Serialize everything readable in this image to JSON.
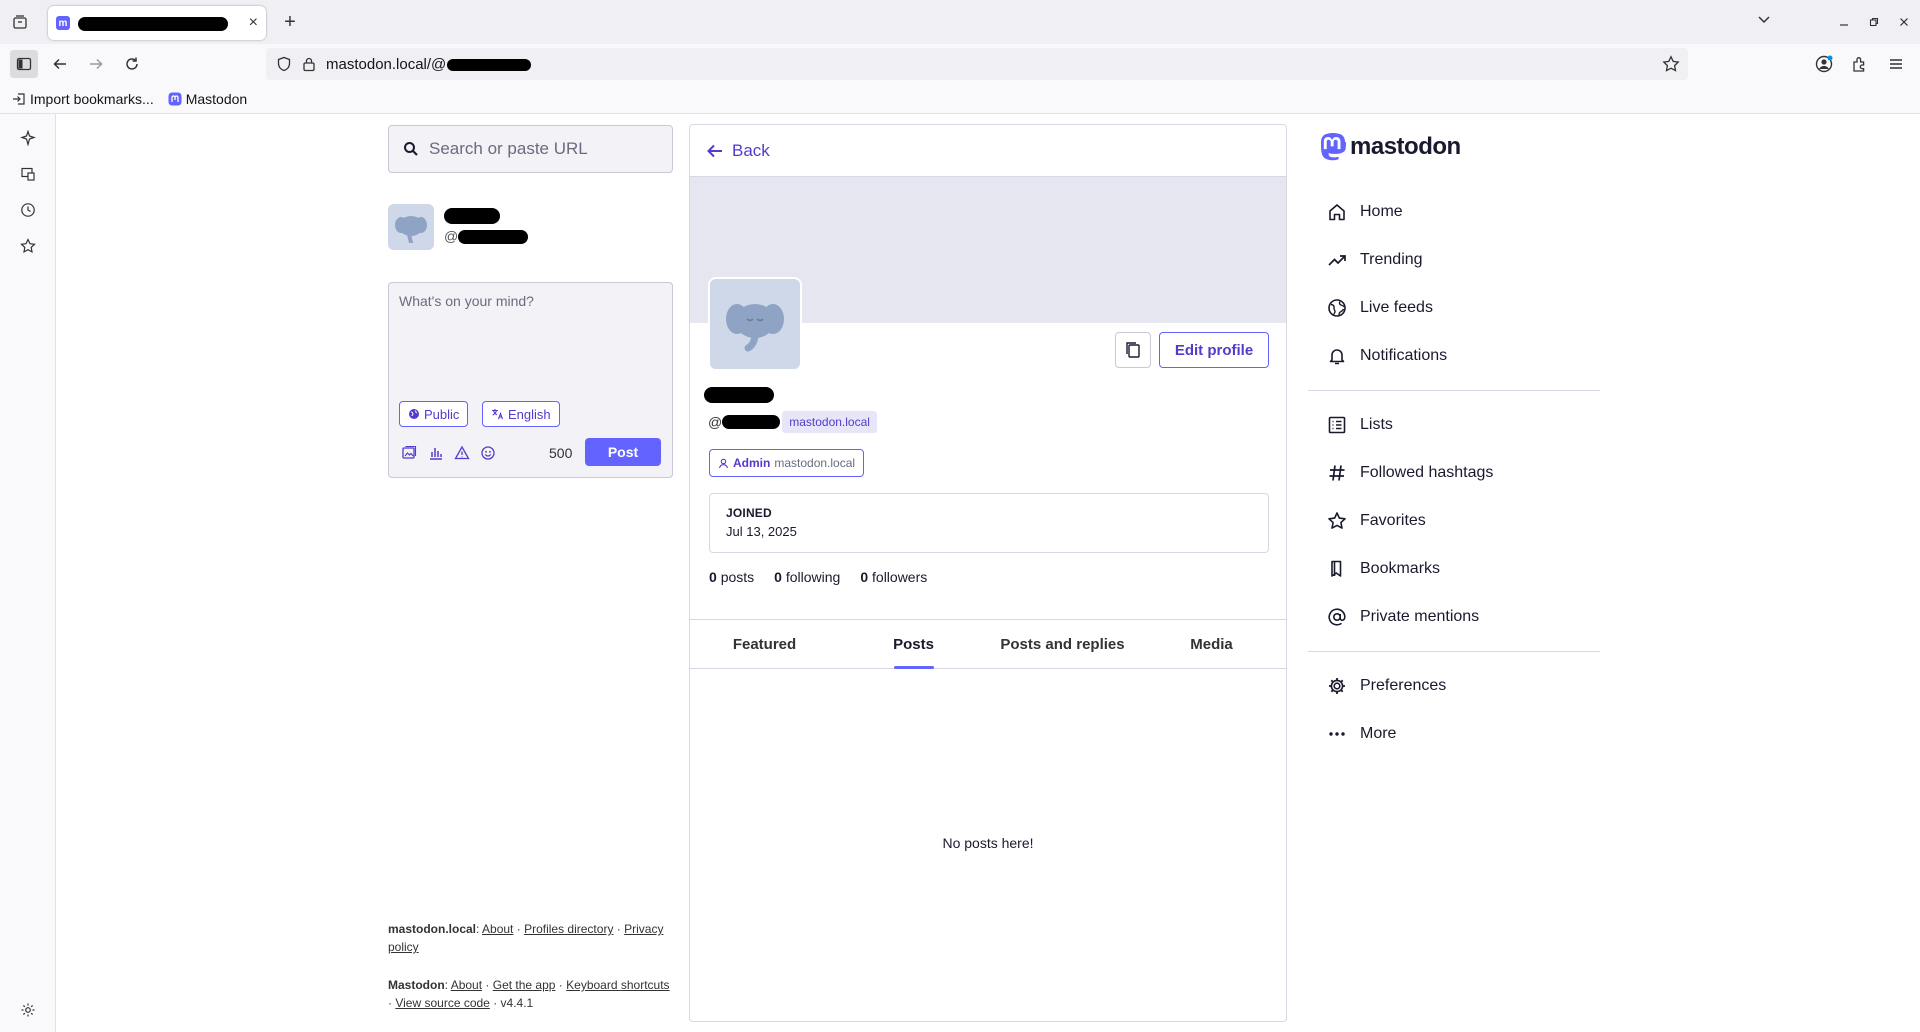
{
  "browser": {
    "tab_title": "",
    "tab_close": "×",
    "new_tab": "+",
    "url": "mastodon.local/@",
    "bookmarks": [
      {
        "label": "Import bookmarks...",
        "icon": "import-icon"
      },
      {
        "label": "Mastodon",
        "icon": "mastodon-favicon"
      }
    ]
  },
  "search": {
    "placeholder": "Search or paste URL"
  },
  "mini_profile": {
    "handle_prefix": "@"
  },
  "composer": {
    "placeholder": "What's on your mind?",
    "visibility": "Public",
    "language": "English",
    "char_count": "500",
    "post_label": "Post"
  },
  "footer": {
    "server_name": "mastodon.local",
    "server_about": "About",
    "profiles_directory": "Profiles directory",
    "privacy_policy": "Privacy policy",
    "app_name": "Mastodon",
    "app_about": "About",
    "get_app": "Get the app",
    "keyboard_shortcuts_1": "Keyboard",
    "keyboard_shortcuts_2": "shortcuts",
    "view_source": "View source code",
    "version": "v4.4.1"
  },
  "profile": {
    "back_label": "Back",
    "edit_profile": "Edit profile",
    "handle_prefix": "@",
    "domain": "mastodon.local",
    "role": "Admin",
    "role_domain": "mastodon.local",
    "joined_label": "JOINED",
    "joined_date": "Jul 13, 2025",
    "counts": {
      "posts_num": "0",
      "posts_label": "posts",
      "following_num": "0",
      "following_label": "following",
      "followers_num": "0",
      "followers_label": "followers"
    },
    "tabs": [
      "Featured",
      "Posts",
      "Posts and replies",
      "Media"
    ],
    "active_tab": "Posts",
    "empty_message": "No posts here!"
  },
  "logo_text": "mastodon",
  "nav": {
    "group1": [
      {
        "label": "Home",
        "icon": "home-icon"
      },
      {
        "label": "Trending",
        "icon": "trending-icon"
      },
      {
        "label": "Live feeds",
        "icon": "globe-icon"
      },
      {
        "label": "Notifications",
        "icon": "bell-icon"
      }
    ],
    "group2": [
      {
        "label": "Lists",
        "icon": "list-icon"
      },
      {
        "label": "Followed hashtags",
        "icon": "hashtag-icon"
      },
      {
        "label": "Favorites",
        "icon": "star-icon"
      },
      {
        "label": "Bookmarks",
        "icon": "bookmark-icon"
      },
      {
        "label": "Private mentions",
        "icon": "at-icon"
      }
    ],
    "group3": [
      {
        "label": "Preferences",
        "icon": "gear-icon"
      },
      {
        "label": "More",
        "icon": "more-icon"
      }
    ]
  },
  "colors": {
    "accent": "#6364ff",
    "accent_text": "#563acc",
    "banner": "#e6e6f0"
  }
}
